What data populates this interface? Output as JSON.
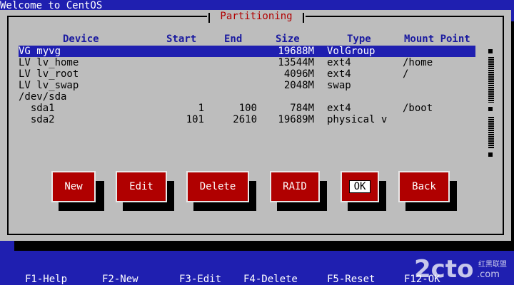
{
  "window": {
    "title": "Welcome to CentOS"
  },
  "dialog": {
    "title": "Partitioning",
    "columns": [
      "Device",
      "Start",
      "End",
      "Size",
      "Type",
      "Mount Point"
    ],
    "rows": [
      {
        "device": "VG myvg",
        "start": "",
        "end": "",
        "size": "19688M",
        "type": "VolGroup",
        "mount": "",
        "selected": true
      },
      {
        "device": "LV lv_home",
        "start": "",
        "end": "",
        "size": "13544M",
        "type": "ext4",
        "mount": "/home"
      },
      {
        "device": "LV lv_root",
        "start": "",
        "end": "",
        "size": "4096M",
        "type": "ext4",
        "mount": "/"
      },
      {
        "device": "LV lv_swap",
        "start": "",
        "end": "",
        "size": "2048M",
        "type": "swap",
        "mount": ""
      },
      {
        "device": "/dev/sda",
        "start": "",
        "end": "",
        "size": "",
        "type": "",
        "mount": ""
      },
      {
        "device": "  sda1",
        "start": "1",
        "end": "100",
        "size": "784M",
        "type": "ext4",
        "mount": "/boot"
      },
      {
        "device": "  sda2",
        "start": "101",
        "end": "2610",
        "size": "19689M",
        "type": "physical v",
        "mount": ""
      }
    ],
    "buttons": {
      "new": "New",
      "edit": "Edit",
      "delete": "Delete",
      "raid": "RAID",
      "ok": "OK",
      "back": "Back"
    }
  },
  "fkeys": [
    "F1-Help",
    "F2-New",
    "F3-Edit",
    "F4-Delete",
    "F5-Reset",
    "F12-OK"
  ],
  "watermark": {
    "brand": "2cto",
    "suffix": ".com",
    "cn": "红黑联盟"
  },
  "colors": {
    "background": "#1f1fb0",
    "dialog": "#bdbdbd",
    "button": "#b00000",
    "title": "#b00000",
    "header": "#1a1aa0"
  }
}
